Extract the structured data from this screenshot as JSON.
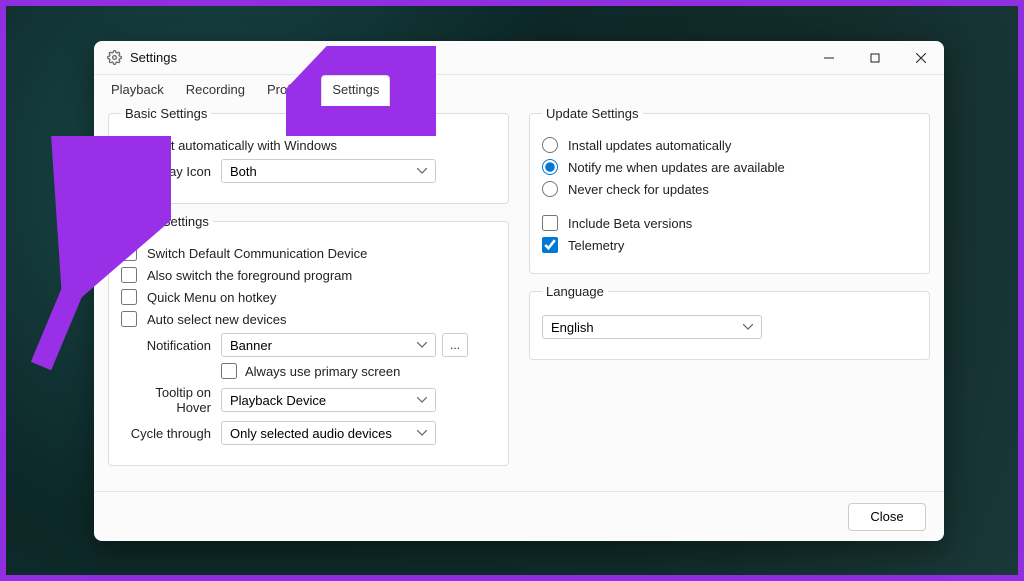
{
  "window": {
    "title": "Settings"
  },
  "tabs": [
    {
      "label": "Playback",
      "active": false
    },
    {
      "label": "Recording",
      "active": false
    },
    {
      "label": "Profiles",
      "active": false
    },
    {
      "label": "Settings",
      "active": true
    }
  ],
  "basic": {
    "legend": "Basic Settings",
    "start_auto": {
      "label": "Start automatically with Windows",
      "checked": true
    },
    "systray_label": "Systray Icon",
    "systray_value": "Both"
  },
  "audio": {
    "legend": "Audio Settings",
    "switch_comm": {
      "label": "Switch Default Communication Device",
      "checked": false
    },
    "also_fg": {
      "label": "Also switch the foreground program",
      "checked": false
    },
    "quick_menu": {
      "label": "Quick Menu on hotkey",
      "checked": false
    },
    "auto_select": {
      "label": "Auto select new devices",
      "checked": false
    },
    "notification_label": "Notification",
    "notification_value": "Banner",
    "notification_more": "...",
    "always_primary": {
      "label": "Always use primary screen",
      "checked": false
    },
    "tooltip_label": "Tooltip on Hover",
    "tooltip_value": "Playback Device",
    "cycle_label": "Cycle through",
    "cycle_value": "Only selected audio devices"
  },
  "update": {
    "legend": "Update Settings",
    "opt_install": "Install updates automatically",
    "opt_notify": "Notify me when updates are available",
    "opt_never": "Never check for updates",
    "selected": "notify",
    "include_beta": {
      "label": "Include Beta versions",
      "checked": false
    },
    "telemetry": {
      "label": "Telemetry",
      "checked": true
    }
  },
  "language": {
    "legend": "Language",
    "value": "English"
  },
  "footer": {
    "close": "Close"
  },
  "colors": {
    "accent": "#0078d4",
    "annotation": "#9a2fe8"
  }
}
